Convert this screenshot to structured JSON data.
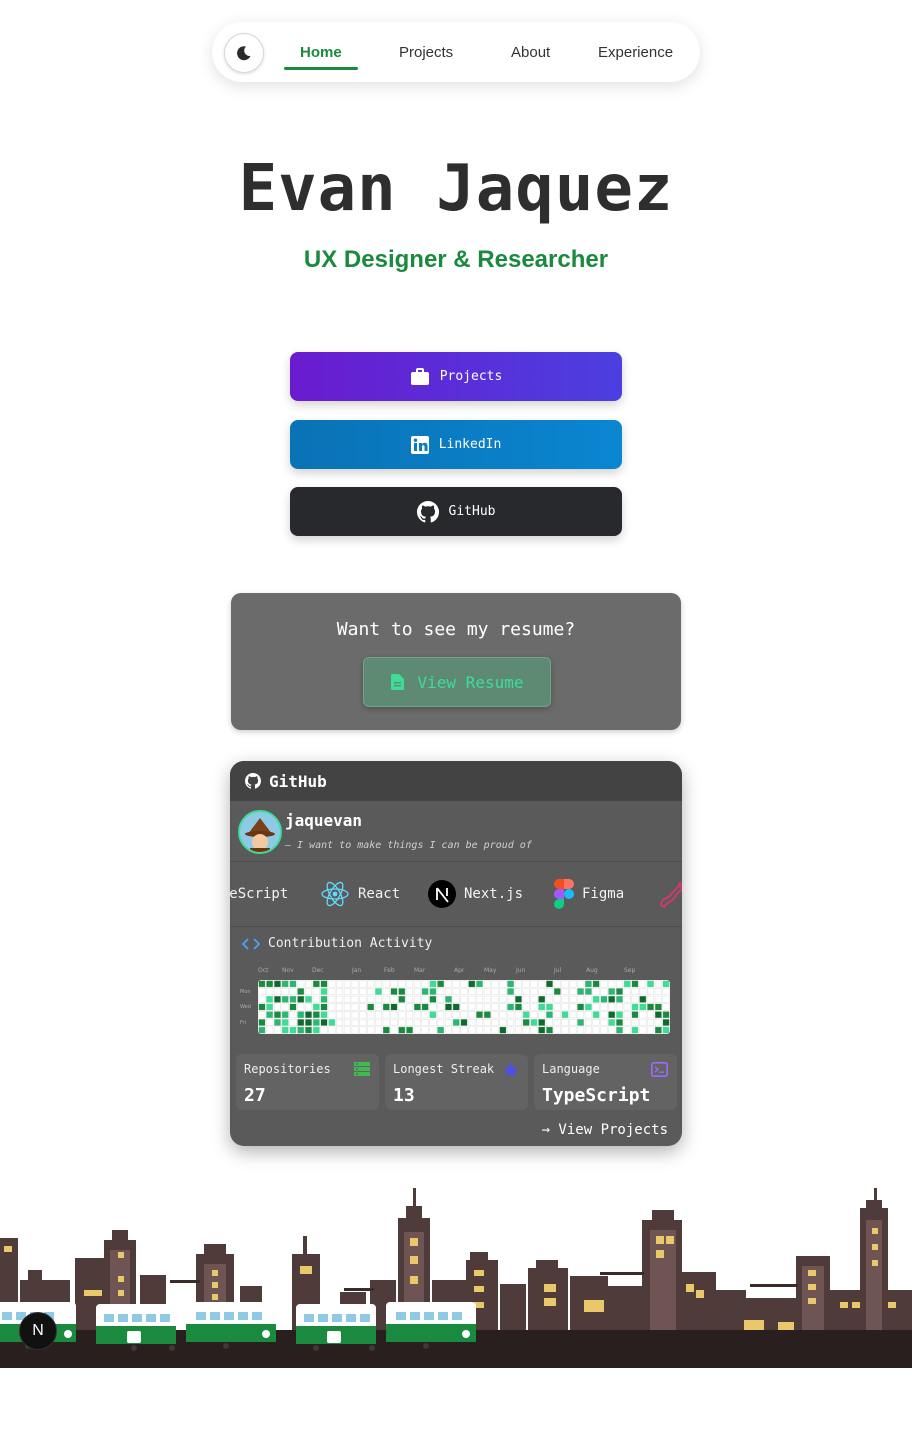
{
  "nav": {
    "items": [
      {
        "label": "Home",
        "active": true
      },
      {
        "label": "Projects",
        "active": false
      },
      {
        "label": "About",
        "active": false
      },
      {
        "label": "Experience",
        "active": false
      }
    ],
    "theme_icon": "moon-icon"
  },
  "hero": {
    "name": "Evan Jaquez",
    "subtitle": "UX Designer & Researcher"
  },
  "buttons": {
    "projects": "Projects",
    "linkedin": "LinkedIn",
    "github": "GitHub"
  },
  "resume": {
    "question": "Want to see my resume?",
    "button": "View Resume"
  },
  "github_card": {
    "title": "GitHub",
    "username": "jaquevan",
    "bio": "— I want to make things I can be proud of",
    "tech": [
      "TypeScript",
      "React",
      "Next.js",
      "Figma"
    ],
    "contribution_title": "Contribution Activity",
    "months": [
      "Oct",
      "Nov",
      "Dec",
      "Jan",
      "Feb",
      "Mar",
      "Apr",
      "May",
      "Jun",
      "Jul",
      "Aug",
      "Sep"
    ],
    "days": [
      "Mon",
      "Wed",
      "Fri"
    ],
    "stats": [
      {
        "label": "Repositories",
        "value": "27"
      },
      {
        "label": "Longest Streak",
        "value": "13"
      },
      {
        "label": "Language",
        "value": "TypeScript"
      }
    ],
    "view_projects": "→ View Projects"
  },
  "colors": {
    "accent": "#1a8a3e",
    "contrib_green": "#3ddc97"
  },
  "next_badge": "N"
}
